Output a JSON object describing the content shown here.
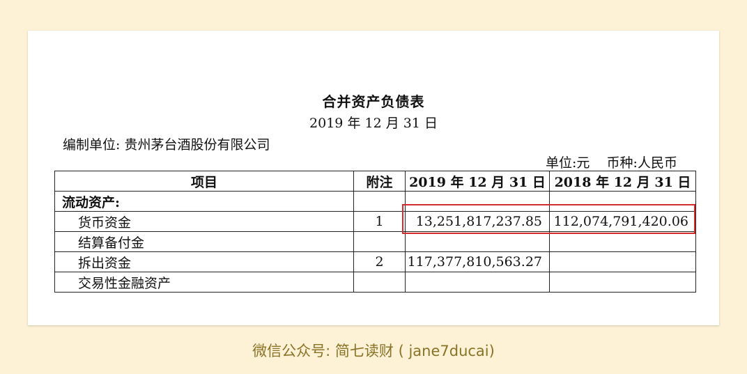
{
  "document": {
    "title": "合并资产负债表",
    "date": "2019 年 12 月 31 日",
    "company": "编制单位: 贵州茅台酒股份有限公司",
    "unit": "单位:元    币种:人民币"
  },
  "table": {
    "headers": [
      "项目",
      "附注",
      "2019 年 12 月 31 日",
      "2018 年 12 月 31 日"
    ],
    "rows": [
      {
        "item": "流动资产:",
        "note": "",
        "y2019": "",
        "y2018": ""
      },
      {
        "item": "货币资金",
        "note": "1",
        "y2019": "13,251,817,237.85",
        "y2018": "112,074,791,420.06"
      },
      {
        "item": "结算备付金",
        "note": "",
        "y2019": "",
        "y2018": ""
      },
      {
        "item": "拆出资金",
        "note": "2",
        "y2019": "117,377,810,563.27",
        "y2018": ""
      },
      {
        "item": "交易性金融资产",
        "note": "",
        "y2019": "",
        "y2018": ""
      }
    ]
  },
  "highlight_color": "#d42b2b",
  "footer": "微信公众号: 简七读财 ( jane7ducai)"
}
